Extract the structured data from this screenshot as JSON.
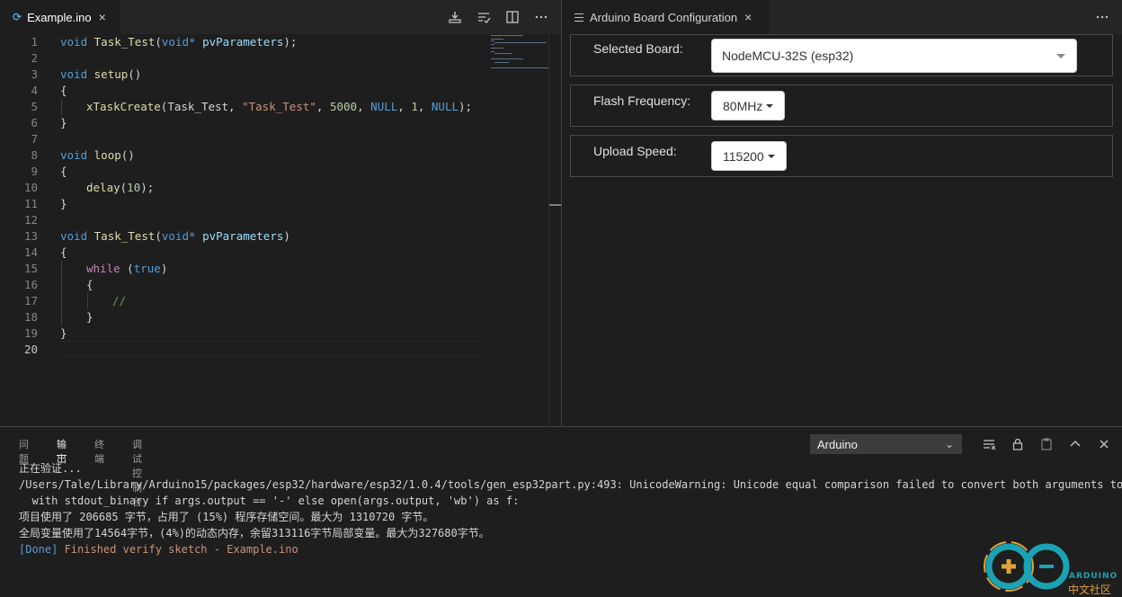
{
  "editor": {
    "tab_title": "Example.ino",
    "tab_close": "×",
    "file_icon_glyph": "⟳",
    "lines": [
      {
        "n": "1"
      },
      {
        "n": "2"
      },
      {
        "n": "3"
      },
      {
        "n": "4"
      },
      {
        "n": "5"
      },
      {
        "n": "6"
      },
      {
        "n": "7"
      },
      {
        "n": "8"
      },
      {
        "n": "9"
      },
      {
        "n": "10"
      },
      {
        "n": "11"
      },
      {
        "n": "12"
      },
      {
        "n": "13"
      },
      {
        "n": "14"
      },
      {
        "n": "15"
      },
      {
        "n": "16"
      },
      {
        "n": "17"
      },
      {
        "n": "18"
      },
      {
        "n": "19"
      },
      {
        "n": "20"
      }
    ],
    "code": {
      "l1": {
        "kw": "void",
        "fn": "Task_Test",
        "p1": "(",
        "kw2": "void*",
        "prm": "pvParameters",
        "p2": ");"
      },
      "l3": {
        "kw": "void",
        "fn": "setup",
        "p": "()"
      },
      "l4": "{",
      "l5": {
        "fn": "xTaskCreate",
        "a": "(Task_Test, ",
        "str": "\"Task_Test\"",
        "b": ", ",
        "num": "5000",
        "c": ", ",
        "kw": "NULL",
        "d": ", ",
        "num2": "1",
        "e": ", ",
        "kw2": "NULL",
        "f": ");"
      },
      "l6": "}",
      "l8": {
        "kw": "void",
        "fn": "loop",
        "p": "()"
      },
      "l9": "{",
      "l10": {
        "fn": "delay",
        "a": "(",
        "num": "10",
        "b": ");"
      },
      "l11": "}",
      "l13": {
        "kw": "void",
        "fn": "Task_Test",
        "p1": "(",
        "kw2": "void*",
        "prm": "pvParameters",
        "p2": ")"
      },
      "l14": "{",
      "l15": {
        "ctrl": "while",
        "a": " (",
        "kw": "true",
        "b": ")"
      },
      "l16": "{",
      "l17": "//",
      "l18": "}",
      "l19": "}"
    },
    "actions": [
      "upload-icon",
      "verify-icon",
      "split-editor-icon",
      "more-icon"
    ]
  },
  "board_config": {
    "tab_title": "Arduino Board Configuration",
    "tab_close": "×",
    "more": "···",
    "selected_board_label": "Selected Board:",
    "selected_board_value": "NodeMCU-32S (esp32)",
    "flash_frequency_label": "Flash Frequency:",
    "flash_frequency_value": "80MHz",
    "upload_speed_label": "Upload Speed:",
    "upload_speed_value": "115200"
  },
  "panel": {
    "tabs": [
      "问题",
      "输出",
      "终端",
      "调试控制台"
    ],
    "active_tab": "输出",
    "channel": "Arduino",
    "output": [
      "正在验证...",
      "/Users/Tale/Library/Arduino15/packages/esp32/hardware/esp32/1.0.4/tools/gen_esp32part.py:493: UnicodeWarning: Unicode equal comparison failed to convert both arguments to",
      "  with stdout_binary if args.output == '-' else open(args.output, 'wb') as f:",
      "项目使用了 206685 字节，占用了 (15%) 程序存储空间。最大为 1310720 字节。",
      "全局变量使用了14564字节，(4%)的动态内存，余留313116字节局部变量。最大为327680字节。"
    ],
    "done_tag": "[Done]",
    "done_message": " Finished verify sketch - Example.ino"
  },
  "watermark": {
    "brand": "ARDUINO",
    "community": "中文社区"
  },
  "colors": {
    "background": "#1e1e1e",
    "keyword": "#569cd6",
    "function": "#dcdcaa",
    "string": "#ce9178",
    "number": "#b5cea8",
    "control": "#c586c0",
    "comment": "#6a9955"
  }
}
